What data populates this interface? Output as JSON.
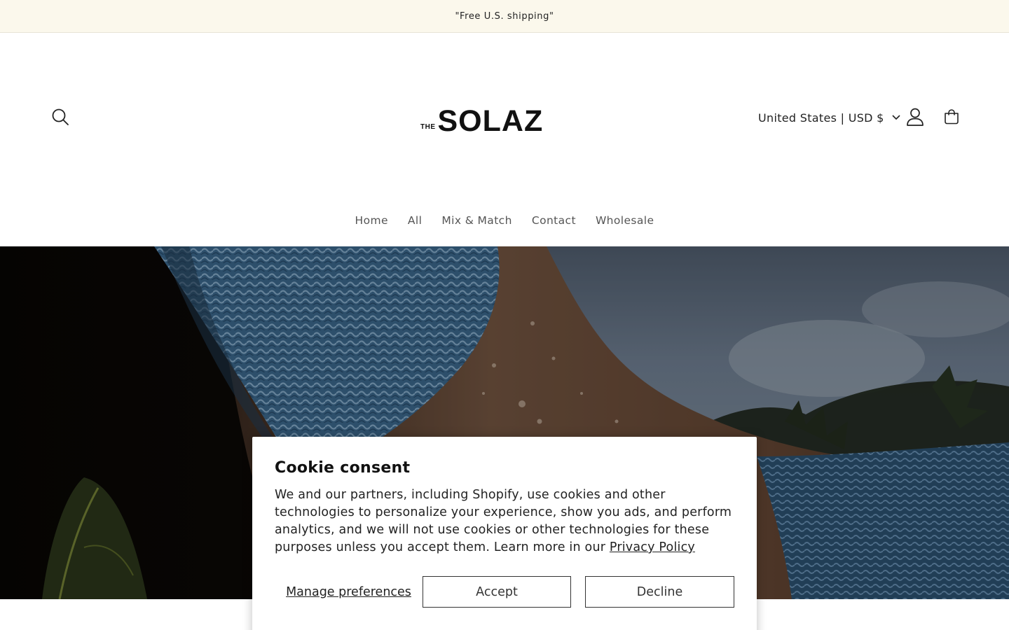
{
  "announcement": {
    "text": "\"Free U.S. shipping\""
  },
  "header": {
    "logo_prefix": "THE",
    "logo_name": "SOLAZ",
    "country_selector": "United States | USD $"
  },
  "nav": {
    "items": [
      {
        "label": "Home"
      },
      {
        "label": "All"
      },
      {
        "label": "Mix & Match"
      },
      {
        "label": "Contact"
      },
      {
        "label": "Wholesale"
      }
    ]
  },
  "icons": {
    "search": "search-icon",
    "account": "account-icon",
    "cart": "cart-icon",
    "country_chevron": "chevron-down-icon"
  },
  "cookie_banner": {
    "title": "Cookie consent",
    "body": "We and our partners, including Shopify, use cookies and other technologies to personalize your experience, show you ads, and perform analytics, and we will not use cookies or other technologies for these purposes unless you accept them. Learn more in our",
    "privacy_link": "Privacy Policy",
    "manage_label": "Manage preferences",
    "accept_label": "Accept",
    "decline_label": "Decline"
  },
  "colors": {
    "announcement_bg": "#fbf8ec",
    "text": "#121212",
    "swimsuit_blue": "#4f7fa6"
  }
}
